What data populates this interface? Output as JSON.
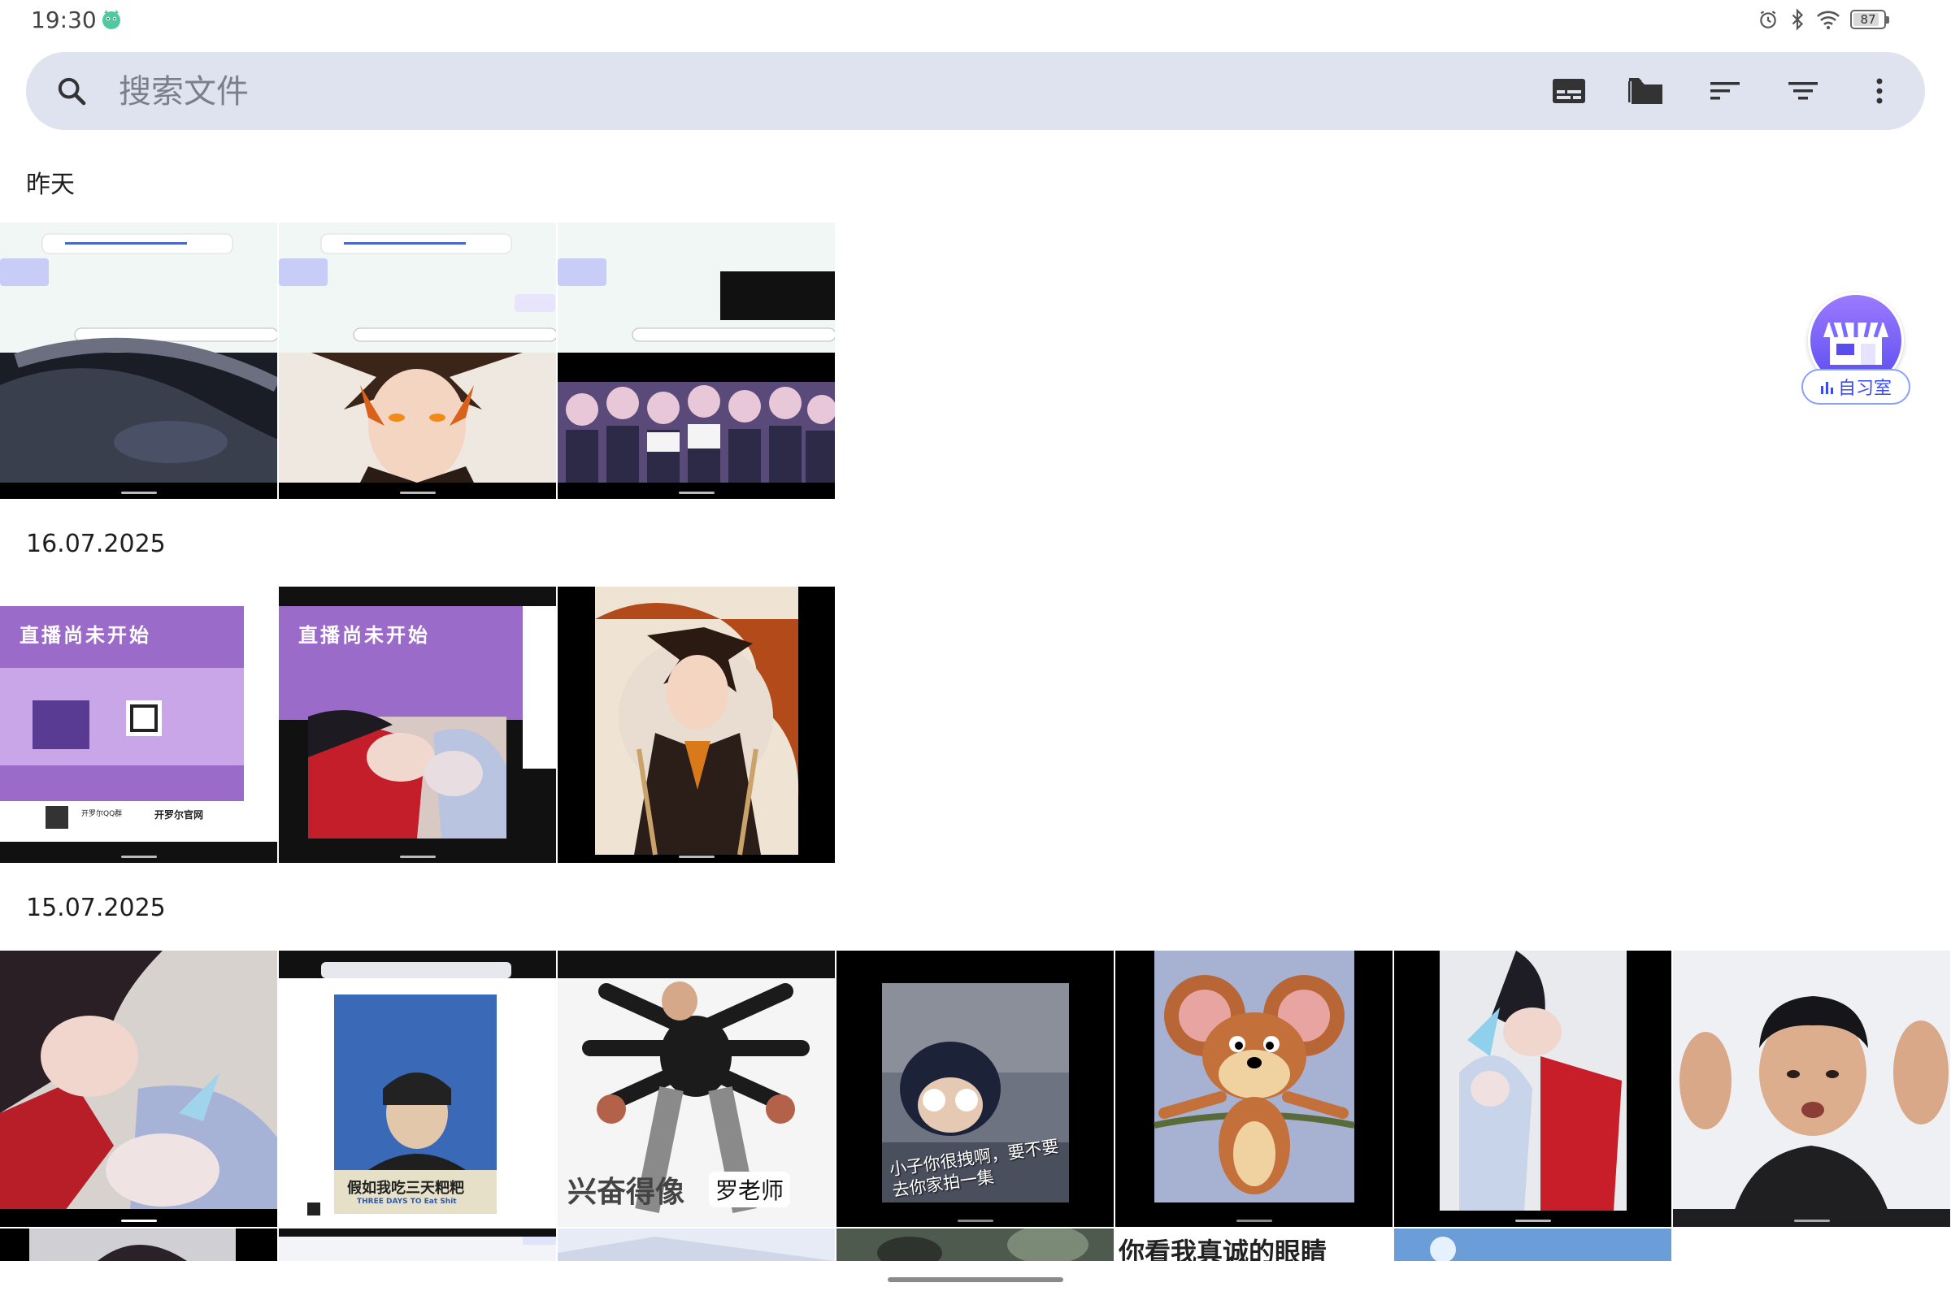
{
  "status_bar": {
    "time": "19:30",
    "battery": "87",
    "battery_level": 0.87,
    "icons": [
      "app-mascot-icon",
      "alarm-icon",
      "bluetooth-icon",
      "wifi-icon",
      "battery-icon"
    ]
  },
  "search": {
    "placeholder": "搜索文件",
    "tools": [
      "subtitles-icon",
      "folder-icon",
      "sort-icon",
      "filter-icon",
      "more-vertical-icon"
    ]
  },
  "sections": [
    {
      "title": "昨天",
      "count": 3
    },
    {
      "title": "16.07.2025",
      "count": 3
    },
    {
      "title": "15.07.2025",
      "count": 7
    }
  ],
  "thumbnails": {
    "live_not_started": "直播尚未开始",
    "qq_group": "开罗尔QQ群",
    "official_site": "开罗尔官网",
    "book_caption": "假如我吃三天粑粑",
    "book_subtitle": "THREE DAYS TO Eat Shit",
    "spider_caption": "兴奋得像",
    "spider_tag": "罗老师",
    "conan_caption": "小子你很拽啊，要不要去你家拍一集",
    "eyes_caption": "你看我真诚的眼睛"
  },
  "float_widget": {
    "label": "自习室",
    "icon": "shop-icon"
  },
  "colors": {
    "search_bg": "#dfe3ef",
    "accent": "#3a4cf0",
    "purple": "#9b6bc9"
  }
}
